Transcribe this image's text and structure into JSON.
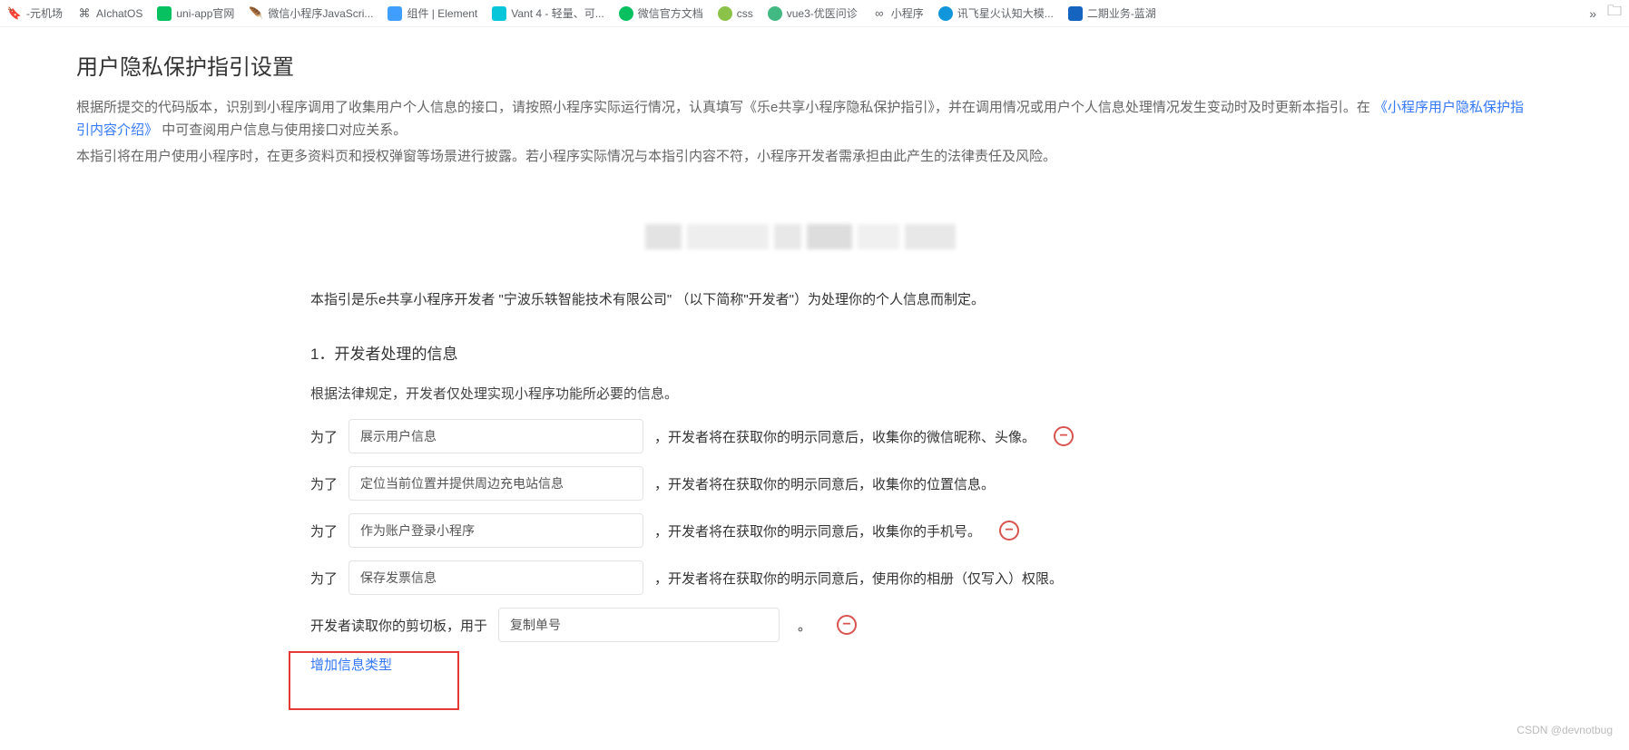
{
  "bookmarks": [
    {
      "label": "-元机场",
      "icon": "generic"
    },
    {
      "label": "AIchatOS",
      "icon": "ai"
    },
    {
      "label": "uni-app官网",
      "icon": "uni"
    },
    {
      "label": "微信小程序JavaScri...",
      "icon": "wx-js"
    },
    {
      "label": "组件 | Element",
      "icon": "element"
    },
    {
      "label": "Vant 4 - 轻量、可...",
      "icon": "vant"
    },
    {
      "label": "微信官方文档",
      "icon": "wechat"
    },
    {
      "label": "css",
      "icon": "css"
    },
    {
      "label": "vue3-优医问诊",
      "icon": "vue"
    },
    {
      "label": "小程序",
      "icon": "mini"
    },
    {
      "label": "讯飞星火认知大模...",
      "icon": "xf"
    },
    {
      "label": "二期业务-蓝湖",
      "icon": "lanhu"
    }
  ],
  "page": {
    "title": "用户隐私保护指引设置",
    "intro1_pre": "根据所提交的代码版本，识别到小程序调用了收集用户个人信息的接口，请按照小程序实际运行情况，认真填写《乐e共享小程序隐私保护指引》，并在调用情况或用户个人信息处理情况发生变动时及时更新本指引。在",
    "intro1_link": "《小程序用户隐私保护指引内容介绍》",
    "intro1_post": "中可查阅用户信息与使用接口对应关系。",
    "intro2": "本指引将在用户使用小程序时，在更多资料页和授权弹窗等场景进行披露。若小程序实际情况与本指引内容不符，小程序开发者需承担由此产生的法律责任及风险。"
  },
  "form": {
    "lead": "本指引是乐e共享小程序开发者 \"宁波乐轶智能技术有限公司\" （以下简称\"开发者\"）为处理你的个人信息而制定。",
    "section1_title": "1．开发者处理的信息",
    "section1_sub": "根据法律规定，开发者仅处理实现小程序功能所必要的信息。",
    "prefix": "为了",
    "rows": [
      {
        "value": "展示用户信息",
        "suffix": "，开发者将在获取你的明示同意后，收集你的微信昵称、头像。",
        "removable": true
      },
      {
        "value": "定位当前位置并提供周边充电站信息",
        "suffix": "，开发者将在获取你的明示同意后，收集你的位置信息。",
        "removable": false
      },
      {
        "value": "作为账户登录小程序",
        "suffix": "，开发者将在获取你的明示同意后，收集你的手机号。",
        "removable": true
      },
      {
        "value": "保存发票信息",
        "suffix": "，开发者将在获取你的明示同意后，使用你的相册（仅写入）权限。",
        "removable": false
      }
    ],
    "clipboard_prefix": "开发者读取你的剪切板，用于",
    "clipboard_value": "复制单号",
    "clipboard_period": "。",
    "add_link": "增加信息类型"
  },
  "watermark": "CSDN @devnotbug"
}
